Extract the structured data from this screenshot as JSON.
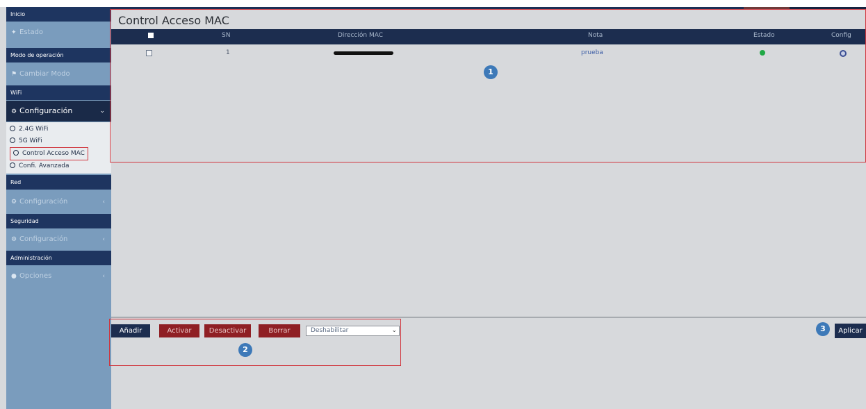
{
  "sidebar": {
    "sections": [
      "Inicio",
      "Modo de operación",
      "WiFi",
      "Red",
      "Seguridad",
      "Administración"
    ],
    "items": {
      "estado": "Estado",
      "cambiar_modo": "Cambiar Modo",
      "wifi_config": "Configuración",
      "red_config": "Configuración",
      "seguridad_config": "Configuración",
      "opciones": "Opciones"
    },
    "wifi_submenu": [
      "2.4G WiFi",
      "5G WiFi",
      "Control Acceso MAC",
      "Confi. Avanzada"
    ],
    "chevron_open": "⌄",
    "chevron_closed": "‹"
  },
  "page": {
    "title": "Control Acceso MAC"
  },
  "table": {
    "columns": {
      "sn": "SN",
      "mac": "Dirección MAC",
      "nota": "Nota",
      "estado": "Estado",
      "config": "Config"
    },
    "rows": [
      {
        "sn": "1",
        "mac": "[redacted]",
        "nota": "prueba",
        "estado_icon": "check-circle-icon",
        "config_icon": "gear-icon"
      }
    ]
  },
  "toolbar": {
    "add": "Añadir",
    "activate": "Activar",
    "deactivate": "Desactivar",
    "delete": "Borrar",
    "filter_value": "Deshabilitar",
    "apply": "Aplicar"
  },
  "badges": [
    "1",
    "2",
    "3"
  ],
  "colors": {
    "sidebar_bg": "#7a9cbd",
    "nav_dark": "#1c2d4f",
    "danger_btn": "#8f1f24",
    "badge": "#3d79b8",
    "callout": "#d0343c",
    "status_ok": "#1fa845"
  }
}
